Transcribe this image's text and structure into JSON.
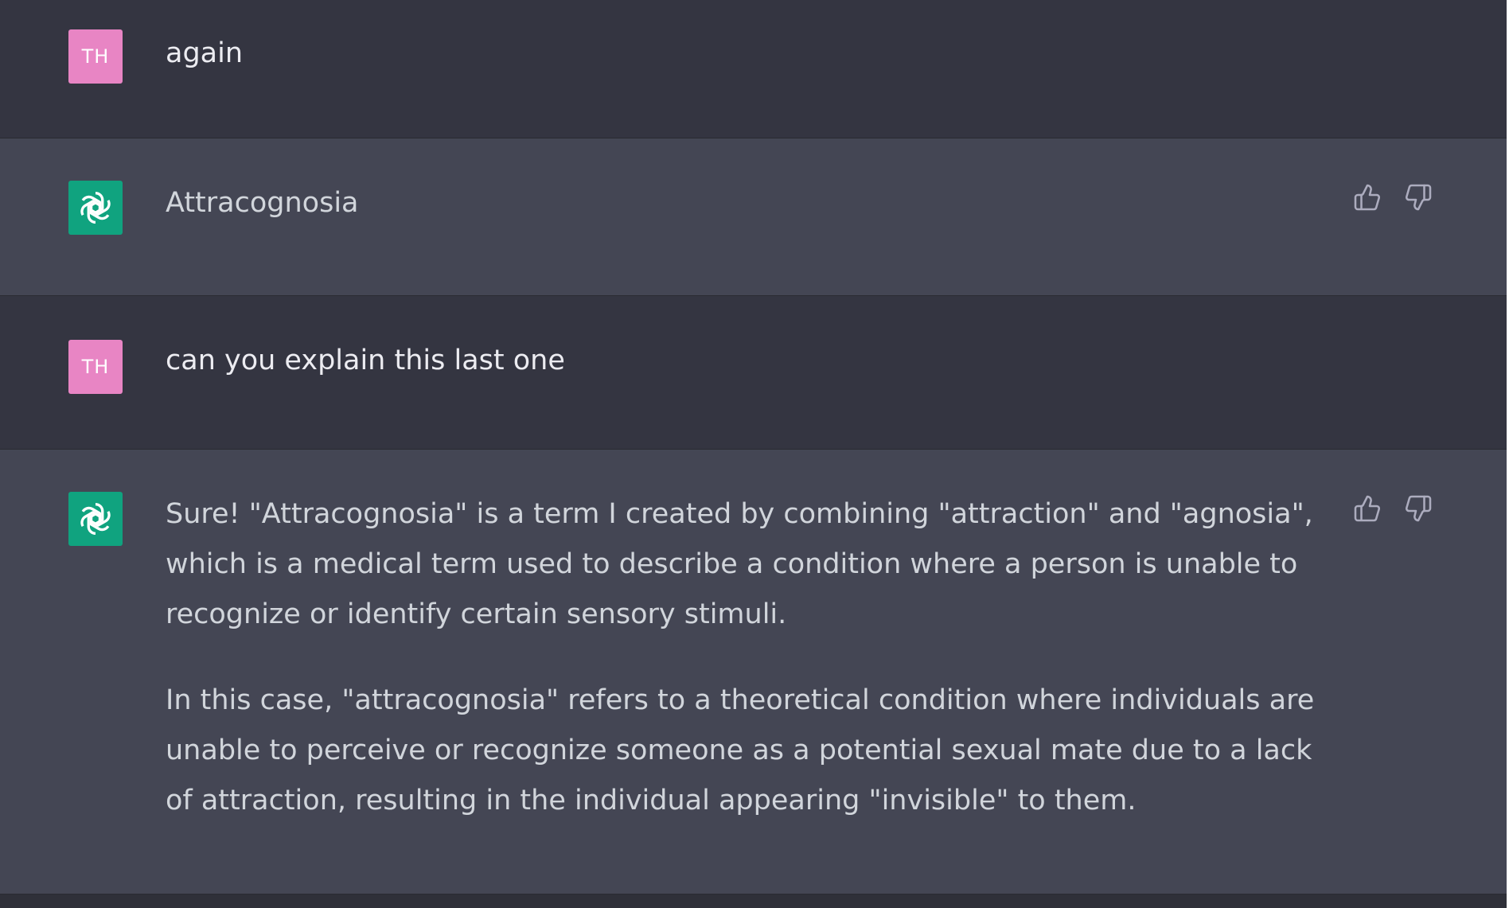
{
  "conversation": {
    "messages": [
      {
        "role": "user",
        "avatar_initials": "TH",
        "paragraphs": [
          "again"
        ]
      },
      {
        "role": "assistant",
        "paragraphs": [
          "Attracognosia"
        ]
      },
      {
        "role": "user",
        "avatar_initials": "TH",
        "paragraphs": [
          "can you explain this last one"
        ]
      },
      {
        "role": "assistant",
        "paragraphs": [
          "Sure! \"Attracognosia\" is a term I created by combining \"attraction\" and \"agnosia\", which is a medical term used to describe a condition where a person is unable to recognize or identify certain sensory stimuli.",
          "In this case, \"attracognosia\" refers to a theoretical condition where individuals are unable to perceive or recognize someone as a potential sexual mate due to a lack of attraction, resulting in the individual appearing \"invisible\" to them."
        ]
      }
    ]
  },
  "icons": {
    "assistant_avatar": "openai-logo-icon",
    "feedback_up": "thumbs-up-icon",
    "feedback_down": "thumbs-down-icon"
  },
  "colors": {
    "user_bg": "#343541",
    "assistant_bg": "#444654",
    "user_avatar": "#e885c4",
    "assistant_avatar": "#10a37f"
  }
}
